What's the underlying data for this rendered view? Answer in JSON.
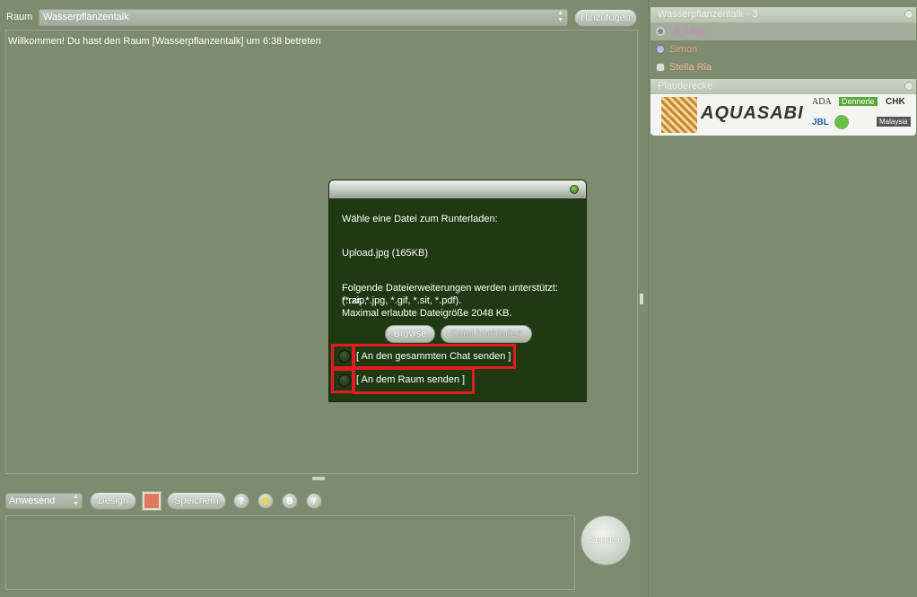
{
  "room": {
    "label": "Raum",
    "selected": "Wasserpflanzentalk",
    "add_button": "Hinzufügen"
  },
  "chat": {
    "welcome": "Willkommen! Du hast den Raum [Wasserpflanzentalk] um 6:38 betreten"
  },
  "toolbar": {
    "status_select": "Anwesend",
    "design_button": "Design",
    "save_button": "Speichern",
    "help_button": "?",
    "bold_button": "B",
    "italic_button": "I",
    "send_button": "Senden",
    "color_swatch": "#e07a5f"
  },
  "sidebar": {
    "users_header": "Wasserpflanzentalk - 3",
    "users": [
      {
        "name": "Lil_Lady",
        "color": "#d87fc9"
      },
      {
        "name": "Simon",
        "color": "#e8a07c"
      },
      {
        "name": "Stella Ria",
        "color": "#f0b89a"
      }
    ],
    "ads_header": "Plauderecke",
    "ad_logo_text": "AQUASABI",
    "ad_small_logos": [
      "ADA",
      "Dennerle",
      "CHK",
      "JBL",
      "Malaysia"
    ]
  },
  "dialog": {
    "prompt": "Wähle eine Datei zum Runterladen:",
    "file": "Upload.jpg (165KB)",
    "extensions_line1": "Folgende Dateierweiterungen werden unterstützt: (*.zip,",
    "extensions_line2": "*.rar, *.jpg, *.gif, *.sit, *.pdf).",
    "max_size": "Maximal erlaubte Dateigröße 2048 KB.",
    "browse_button": "Browse",
    "upload_button": "Datei hochladen",
    "option_chat": "[ An den gesammten Chat senden ]",
    "option_room": "[ An dem Raum senden ]"
  }
}
